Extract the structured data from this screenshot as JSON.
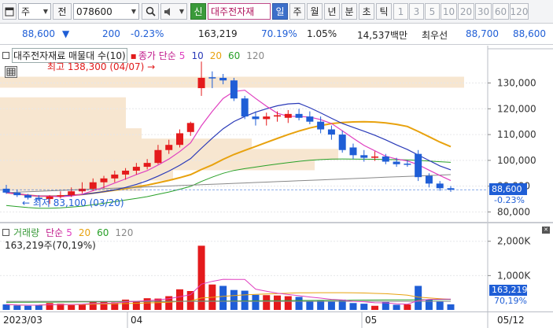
{
  "toolbar": {
    "market": "주",
    "type_prefix": "전",
    "code": "078600",
    "stock_name": "대주전자재",
    "credit_badge": "신",
    "periods": [
      {
        "label": "일",
        "selected": true
      },
      {
        "label": "주",
        "selected": false
      },
      {
        "label": "월",
        "selected": false
      },
      {
        "label": "년",
        "selected": false
      },
      {
        "label": "분",
        "selected": false
      },
      {
        "label": "초",
        "selected": false
      },
      {
        "label": "틱",
        "selected": false
      }
    ],
    "intervals": [
      "1",
      "3",
      "5",
      "10",
      "20",
      "30",
      "60",
      "120"
    ]
  },
  "quote": {
    "price": "88,600",
    "change_arrow": "▼",
    "change": "200",
    "change_rate": "-0.23%",
    "volume": "163,219",
    "volume_ratio": "70.19%",
    "turnover_rate": "1.05%",
    "amount": "14,537백만",
    "best_label": "최우선",
    "ask": "88,700",
    "bid": "88,600"
  },
  "price_pane": {
    "title": "대주전자재료 매물대 수(10)",
    "ma_label_prefix": "종가 단순",
    "ma_periods": [
      "5",
      "10",
      "20",
      "60",
      "120"
    ],
    "high_label": "최고 138,300 (04/07)",
    "low_label": "최저 83,100 (03/20)",
    "yaxis_labels": [
      "130,000",
      "120,000",
      "110,000",
      "100,000",
      "90,000",
      "80,000"
    ],
    "current_price": "88,600",
    "current_change": "-0.23%"
  },
  "volume_pane": {
    "title_prefix": "거래량",
    "ma_label_prefix": "단순",
    "ma_periods": [
      "5",
      "20",
      "60",
      "120"
    ],
    "current_info": "163,219주(70,19%)",
    "yaxis_labels": [
      "2,000K",
      "1,000K"
    ],
    "current_volume": "163,219",
    "current_ratio": "70,19%"
  },
  "xaxis": {
    "labels": [
      "2023/03",
      "04",
      "05",
      "05/12"
    ]
  },
  "colors": {
    "up": "#e41a1c",
    "down": "#1f5ed6",
    "ma5": "#e040c0",
    "ma10": "#2a3ab8",
    "ma20": "#e8a20e",
    "ma60": "#28a028",
    "ma120": "#888888",
    "volume_profile": "#f7e6d0"
  },
  "chart_data": {
    "type": "candlestick",
    "x": [
      "03/14",
      "03/15",
      "03/16",
      "03/17",
      "03/20",
      "03/21",
      "03/22",
      "03/23",
      "03/24",
      "03/27",
      "03/28",
      "03/29",
      "03/30",
      "03/31",
      "04/03",
      "04/04",
      "04/05",
      "04/06",
      "04/07",
      "04/10",
      "04/11",
      "04/12",
      "04/13",
      "04/14",
      "04/17",
      "04/18",
      "04/19",
      "04/20",
      "04/21",
      "04/24",
      "04/25",
      "04/26",
      "04/27",
      "04/28",
      "05/02",
      "05/03",
      "05/04",
      "05/08",
      "05/09",
      "05/10",
      "05/11",
      "05/12"
    ],
    "open": [
      89000,
      87500,
      86500,
      85500,
      85000,
      86000,
      86500,
      88000,
      89000,
      91500,
      93000,
      94500,
      96000,
      97500,
      99000,
      104000,
      106000,
      111000,
      128000,
      132000,
      132000,
      131000,
      124000,
      117000,
      116000,
      117000,
      116500,
      118000,
      117000,
      115000,
      112000,
      110000,
      105000,
      102000,
      101000,
      101500,
      99500,
      98500,
      102500,
      94000,
      91000,
      89200
    ],
    "high": [
      90500,
      88500,
      87000,
      86500,
      86500,
      88000,
      89500,
      91500,
      93000,
      94000,
      96000,
      97000,
      99000,
      100500,
      106000,
      108000,
      112000,
      115000,
      138300,
      134500,
      133500,
      132000,
      125000,
      119000,
      118500,
      119000,
      119500,
      120000,
      119000,
      117000,
      113500,
      111500,
      106500,
      104000,
      103500,
      102500,
      101000,
      100000,
      104000,
      95000,
      92000,
      90000
    ],
    "low": [
      87000,
      85800,
      84800,
      84200,
      83100,
      85200,
      85800,
      87200,
      88200,
      89200,
      91500,
      92500,
      94500,
      96500,
      98500,
      102500,
      105000,
      109500,
      125000,
      128000,
      129500,
      123000,
      116000,
      113500,
      113500,
      115000,
      114500,
      115500,
      114000,
      110500,
      108000,
      103000,
      100500,
      99500,
      99800,
      98500,
      97500,
      97500,
      92000,
      89500,
      88200,
      87800
    ],
    "close": [
      87500,
      86500,
      85500,
      85000,
      86000,
      86500,
      88000,
      89000,
      91500,
      93000,
      94500,
      96000,
      97500,
      99000,
      104000,
      106000,
      110500,
      114500,
      132000,
      132000,
      131000,
      124000,
      117000,
      116000,
      117000,
      117500,
      118000,
      116500,
      115000,
      112000,
      110000,
      104000,
      102000,
      101000,
      101500,
      99500,
      98500,
      98500,
      93500,
      91000,
      89200,
      88600
    ],
    "volume": [
      160,
      130,
      120,
      150,
      200,
      180,
      140,
      160,
      250,
      230,
      220,
      300,
      260,
      340,
      330,
      400,
      600,
      550,
      1870,
      740,
      700,
      580,
      560,
      440,
      430,
      420,
      400,
      380,
      250,
      270,
      240,
      300,
      200,
      180,
      120,
      230,
      150,
      160,
      700,
      300,
      250,
      163
    ]
  }
}
